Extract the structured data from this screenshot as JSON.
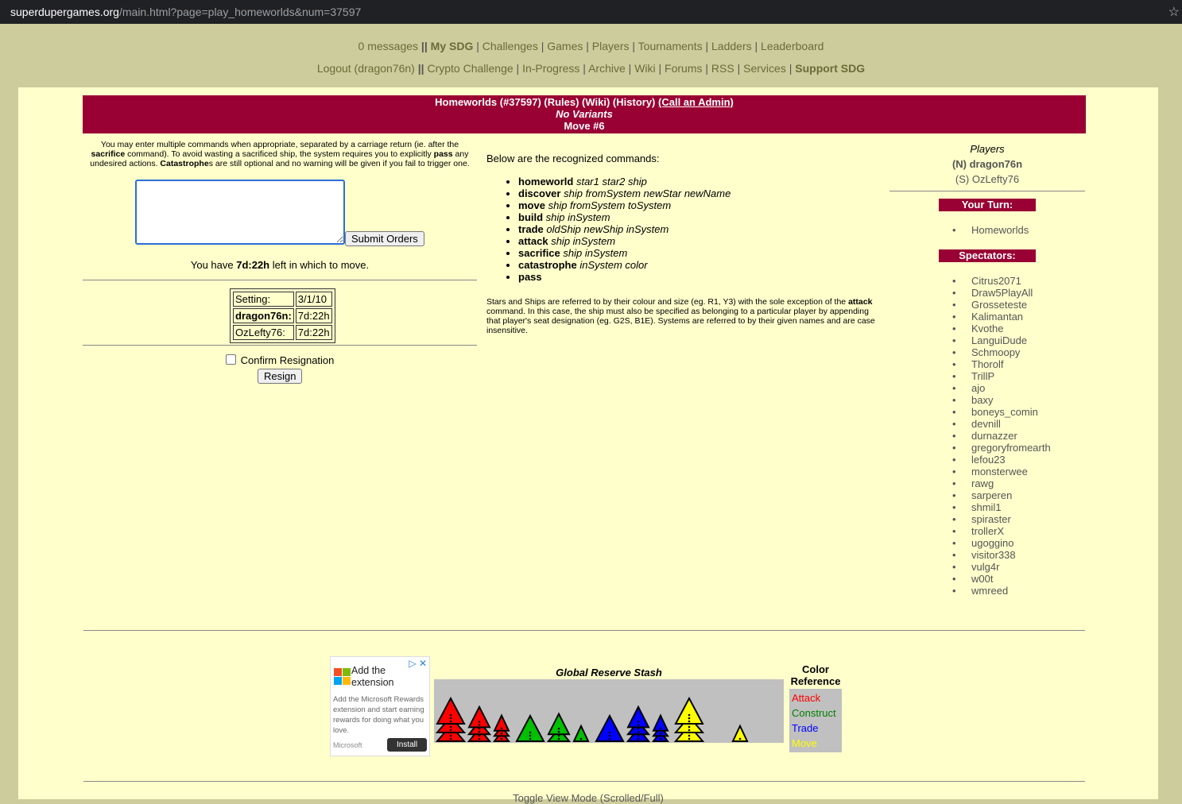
{
  "browser": {
    "url_host": "superdupergames.org",
    "url_path": "/main.html?page=play_homeworlds&num=37597"
  },
  "nav": {
    "row1": [
      {
        "label": "0 messages",
        "sep": " || "
      },
      {
        "label": "My SDG",
        "sep": " | "
      },
      {
        "label": "Challenges",
        "sep": " | "
      },
      {
        "label": "Games",
        "sep": " | "
      },
      {
        "label": "Players",
        "sep": " | "
      },
      {
        "label": "Tournaments",
        "sep": " | "
      },
      {
        "label": "Ladders",
        "sep": " | "
      },
      {
        "label": "Leaderboard",
        "sep": ""
      }
    ],
    "row2": [
      {
        "label": "Logout (dragon76n)",
        "sep": " || "
      },
      {
        "label": "Crypto Challenge",
        "sep": " | "
      },
      {
        "label": "In-Progress",
        "sep": " | "
      },
      {
        "label": "Archive",
        "sep": " | "
      },
      {
        "label": "Wiki",
        "sep": " | "
      },
      {
        "label": "Forums",
        "sep": " | "
      },
      {
        "label": "RSS",
        "sep": " | "
      },
      {
        "label": "Services",
        "sep": " | "
      },
      {
        "label": "Support SDG",
        "sep": ""
      }
    ]
  },
  "header": {
    "title": "Homeworlds (#37597) (Rules) (Wiki) (History)",
    "call_admin": "(Call an Admin)",
    "variants": "No Variants",
    "move": "Move #6"
  },
  "left": {
    "instr_1": "You may enter multiple commands when appropriate, separated by a carriage return (ie. after the ",
    "instr_sacrifice": "sacrifice",
    "instr_2": " command). To avoid wasting a sacrificed ship, the system requires you to explicitly ",
    "instr_pass": "pass",
    "instr_3": " any undesired actions. ",
    "instr_catastrophe": "Catastrophe",
    "instr_4": "s are still optional and no warning will be given if you fail to trigger one.",
    "submit_label": "Submit Orders",
    "time_prefix": "You have ",
    "time_value": "7d:22h",
    "time_suffix": " left in which to move.",
    "clock": {
      "setting_label": "Setting:",
      "setting_value": "3/1/10",
      "p1_label": "dragon76n:",
      "p1_value": "7d:22h",
      "p2_label": "OzLefty76:",
      "p2_value": "7d:22h"
    },
    "confirm_label": "Confirm Resignation",
    "resign_label": "Resign"
  },
  "middle": {
    "intro": "Below are the recognized commands:",
    "commands": [
      {
        "name": "homeworld",
        "args": "star1 star2 ship"
      },
      {
        "name": "discover",
        "args": "ship fromSystem newStar newName"
      },
      {
        "name": "move",
        "args": "ship fromSystem toSystem"
      },
      {
        "name": "build",
        "args": "ship inSystem"
      },
      {
        "name": "trade",
        "args": "oldShip newShip inSystem"
      },
      {
        "name": "attack",
        "args": "ship inSystem"
      },
      {
        "name": "sacrifice",
        "args": "ship inSystem"
      },
      {
        "name": "catastrophe",
        "args": "inSystem color"
      },
      {
        "name": "pass",
        "args": ""
      }
    ],
    "note_1": "Stars and Ships are referred to by their colour and size (eg. R1, Y3) with the sole exception of the ",
    "note_attack": "attack",
    "note_2": " command. In this case, the ship must also be specified as belonging to a particular player by appending that player's seat designation (eg. G2S, B1E). Systems are referred to by their given names and are case insensitive."
  },
  "right": {
    "players_title": "Players",
    "player1": "(N) dragon76n",
    "player2": "(S) OzLefty76",
    "your_turn_label": "Your Turn:",
    "your_turn_items": [
      "Homeworlds"
    ],
    "spectators_label": "Spectators:",
    "spectators": [
      "Citrus2071",
      "Draw5PlayAll",
      "Grosseteste",
      "Kalimantan",
      "Kvothe",
      "LanguiDude",
      "Schmoopy",
      "Thorolf",
      "TrillP",
      "ajo",
      "baxy",
      "boneys_comin",
      "devnill",
      "durnazzer",
      "gregoryfromearth",
      "lefou23",
      "monsterwee",
      "rawg",
      "sarperen",
      "shmil1",
      "spiraster",
      "trollerX",
      "ugoggino",
      "visitor338",
      "vulg4r",
      "w00t",
      "wmreed"
    ]
  },
  "ad": {
    "headline": "Add the extension",
    "body": "Add the Microsoft Rewards extension and start earning rewards for doing what you love.",
    "brand": "Microsoft",
    "install_label": "Install"
  },
  "stash": {
    "title": "Global Reserve Stash",
    "piles": [
      {
        "color": "#ff0000",
        "counts": [
          3,
          3,
          3
        ]
      },
      {
        "color": "#00c000",
        "counts": [
          1,
          2,
          1
        ]
      },
      {
        "color": "#0000ff",
        "counts": [
          1,
          3,
          3
        ]
      },
      {
        "color": "#ffff00",
        "counts": [
          3,
          0,
          1
        ]
      }
    ]
  },
  "color_ref": {
    "title": "Color Reference",
    "items": [
      {
        "label": "Attack",
        "color": "#ff0000"
      },
      {
        "label": "Construct",
        "color": "#008000"
      },
      {
        "label": "Trade",
        "color": "#0000ff"
      },
      {
        "label": "Move",
        "color": "#ffff00"
      }
    ]
  },
  "footer": {
    "toggle": "Toggle View Mode (Scrolled/Full)"
  },
  "colors": {
    "page_bg": "#cdcc9c",
    "panel_bg": "#ffffcc",
    "header_bg": "#990033"
  }
}
